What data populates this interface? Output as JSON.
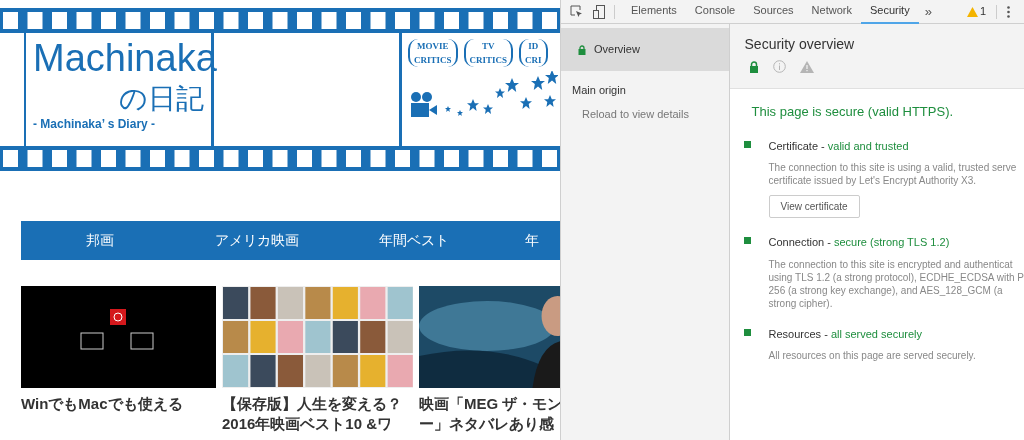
{
  "site": {
    "logo": {
      "title": "Machinaka",
      "subtitle": "の日記",
      "tagline": "- Machinaka’ s Diary -"
    },
    "badges": [
      {
        "top": "MOVIE",
        "bottom": "CRITICS"
      },
      {
        "top": "TV",
        "bottom": "CRITICS"
      },
      {
        "top": "ID",
        "bottom": "CRI"
      }
    ],
    "nav": [
      "邦画",
      "アメリカ映画",
      "年間ベスト",
      "年"
    ],
    "articles": [
      {
        "kind": "picture",
        "title_lines": [
          "WinでもMacでも使える"
        ]
      },
      {
        "kind": "picture",
        "title_lines": [
          "【保存版】人生を変える？",
          "2016年映画ベスト10 &ワ"
        ]
      },
      {
        "kind": "picture",
        "title_lines": [
          "映画「MEG ザ・モン",
          "ー」ネタバレあり感"
        ]
      }
    ]
  },
  "devtools": {
    "tabs": [
      {
        "label": "Elements",
        "selected": false
      },
      {
        "label": "Console",
        "selected": false
      },
      {
        "label": "Sources",
        "selected": false
      },
      {
        "label": "Network",
        "selected": false
      },
      {
        "label": "Security",
        "selected": true
      }
    ],
    "more": "»",
    "warnings": "1",
    "sidebar": {
      "items": [
        {
          "label": "Overview",
          "selected": true
        }
      ],
      "section": "Main origin",
      "hint": "Reload to view details"
    },
    "title": "Security overview",
    "filters": [
      {
        "kind": "lock",
        "selected": true
      },
      {
        "kind": "info",
        "selected": false
      },
      {
        "kind": "warning",
        "selected": false
      }
    ],
    "summary": "This page is secure (valid HTTPS).",
    "sections": [
      {
        "name": "Certificate - ",
        "status": "valid and trusted",
        "color": "#1e8e3e",
        "lines": [
          "The connection to this site is using a valid, trusted serve",
          "certificate issued by Let's Encrypt Authority X3."
        ],
        "button": "View certificate"
      },
      {
        "name": "Connection - ",
        "status": "secure (strong TLS 1.2)",
        "color": "#1e8e3e",
        "lines": [
          "The connection to this site is encrypted and authenticat",
          "using TLS 1.2 (a strong protocol), ECDHE_ECDSA with P",
          "256 (a strong key exchange), and AES_128_GCM (a",
          "strong cipher)."
        ]
      },
      {
        "name": "Resources - ",
        "status": "all served securely",
        "color": "#1e8e3e",
        "lines": [
          "All resources on this page are served securely."
        ]
      }
    ]
  }
}
